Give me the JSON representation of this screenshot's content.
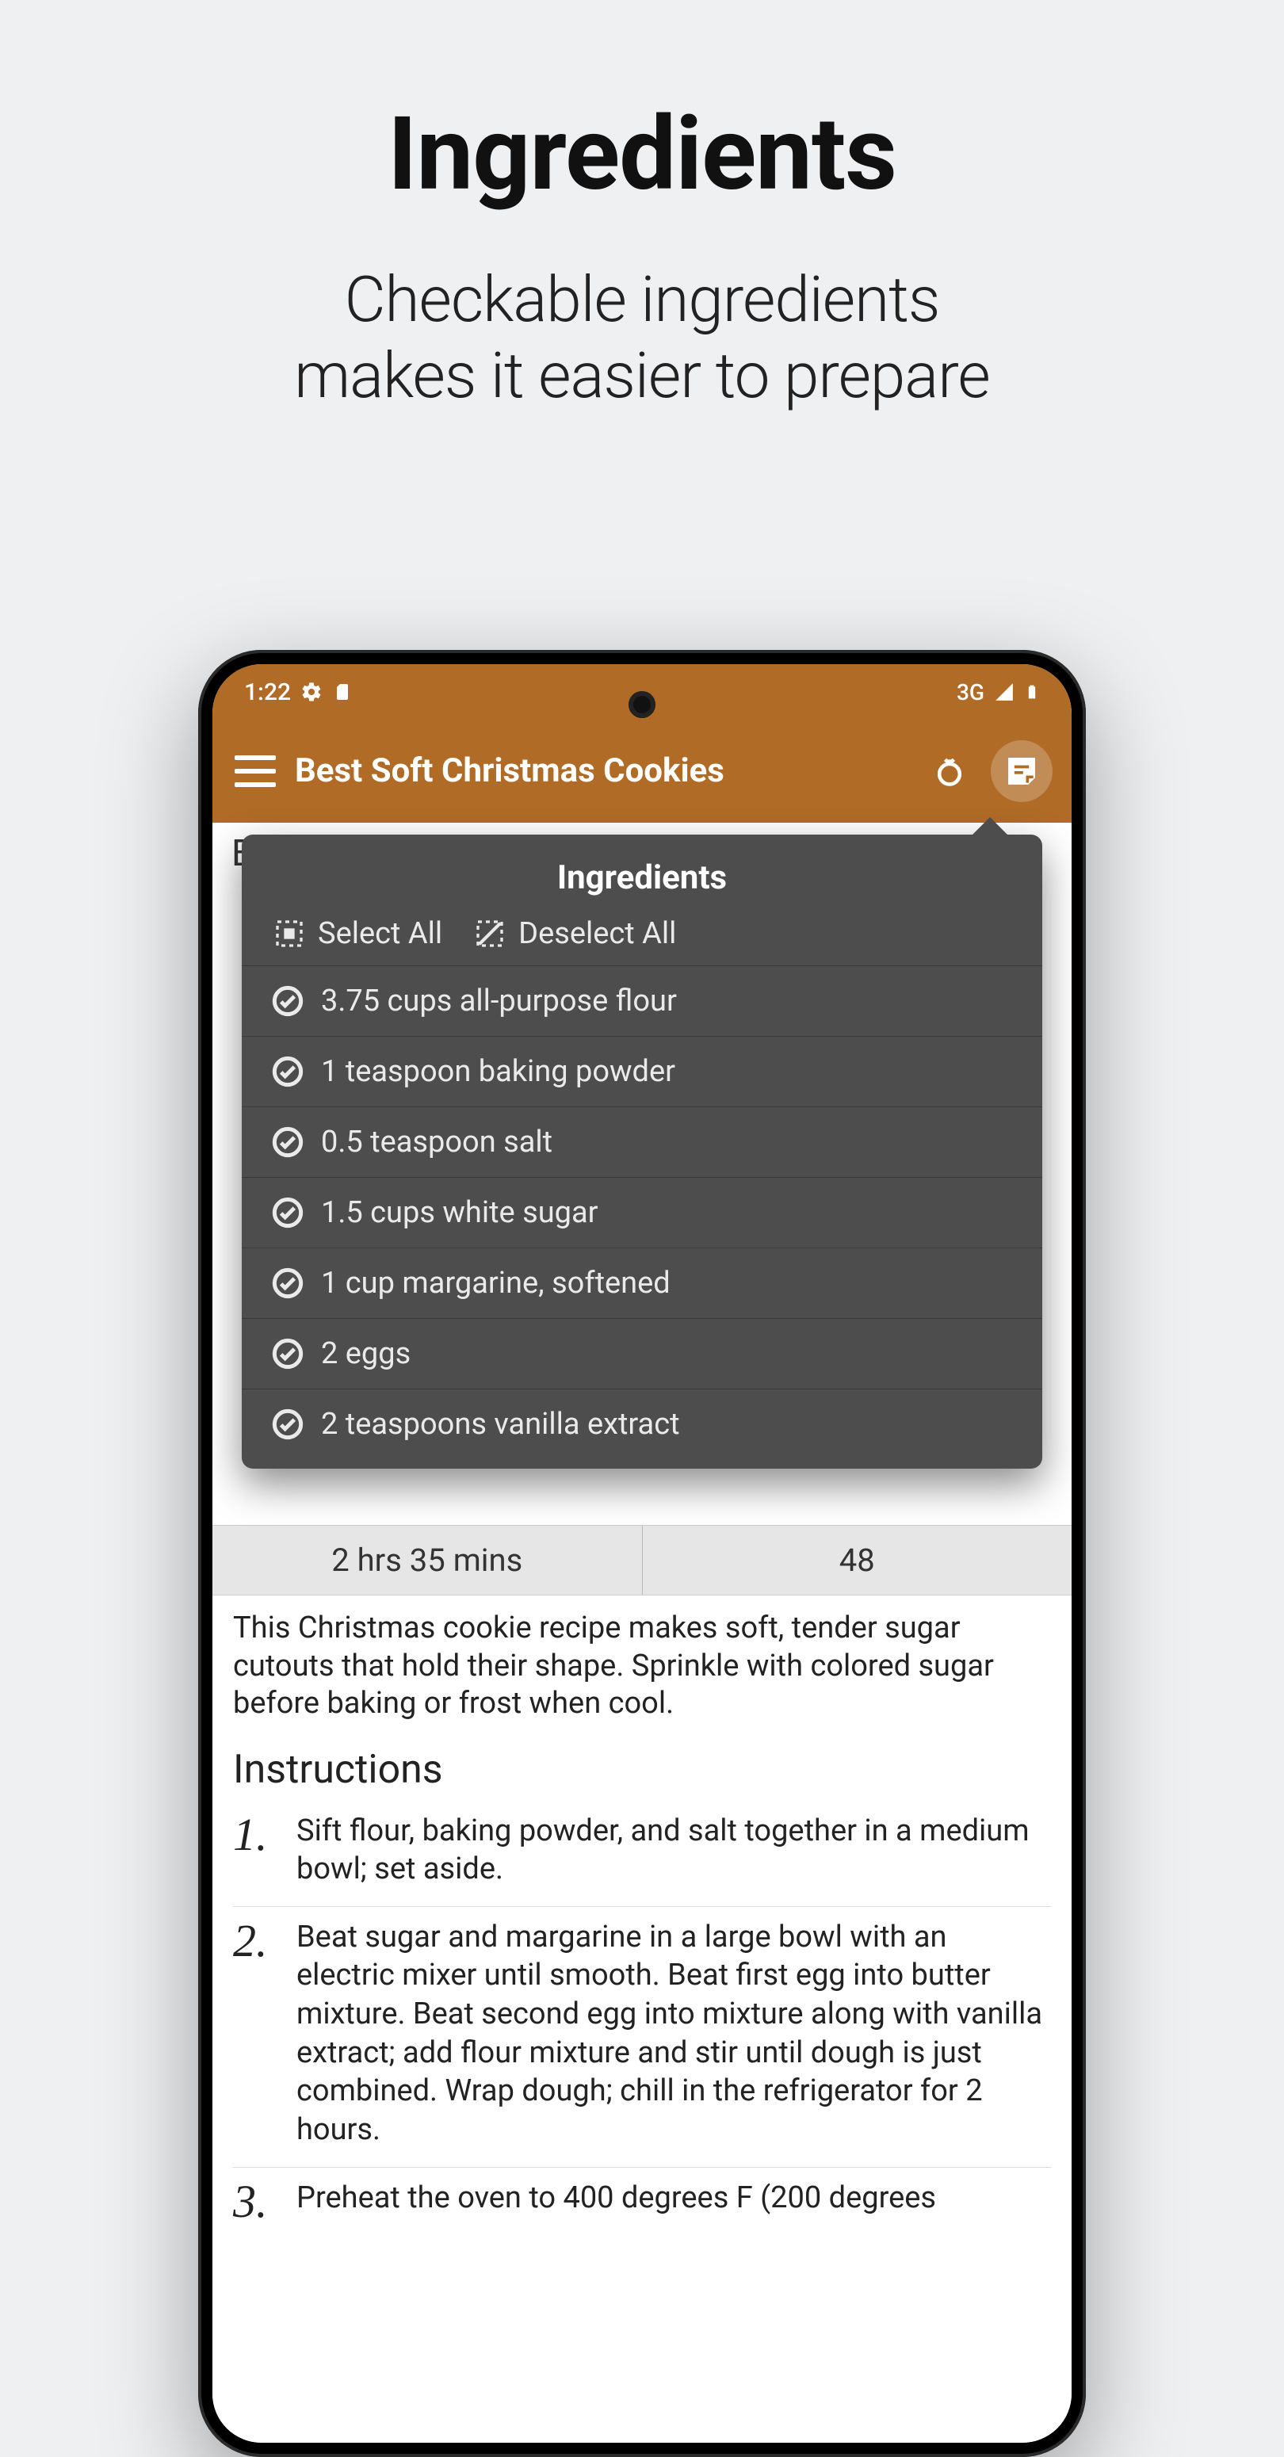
{
  "promo": {
    "title": "Ingredients",
    "subtitle_line1": "Checkable ingredients",
    "subtitle_line2": "makes it easier to prepare"
  },
  "statusbar": {
    "time": "1:22",
    "network": "3G"
  },
  "appbar": {
    "title": "Best Soft Christmas Cookies"
  },
  "page": {
    "title_under": "Best Soft Christmas Cookies",
    "total_time": "2 hrs 35 mins",
    "yield": "48",
    "description": "This Christmas cookie recipe makes soft, tender sugar cutouts that hold their shape. Sprinkle with colored sugar before baking or frost when cool.",
    "instructions_heading": "Instructions",
    "steps": [
      {
        "num": "1.",
        "text": "Sift flour, baking powder, and salt together in a medium bowl; set aside."
      },
      {
        "num": "2.",
        "text": "Beat sugar and margarine in a large bowl with an electric mixer until smooth. Beat first egg into butter mixture. Beat second egg into mixture along with vanilla extract; add flour mixture and stir until dough is just combined. Wrap dough; chill in the refrigerator for 2 hours."
      },
      {
        "num": "3.",
        "text": "Preheat the oven to 400 degrees F (200 degrees"
      }
    ]
  },
  "popup": {
    "title": "Ingredients",
    "select_all": "Select All",
    "deselect_all": "Deselect All",
    "items": [
      "3.75 cups all-purpose flour",
      "1 teaspoon baking powder",
      "0.5 teaspoon salt",
      "1.5 cups white sugar",
      "1 cup margarine, softened",
      "2 eggs",
      "2 teaspoons vanilla extract"
    ]
  }
}
